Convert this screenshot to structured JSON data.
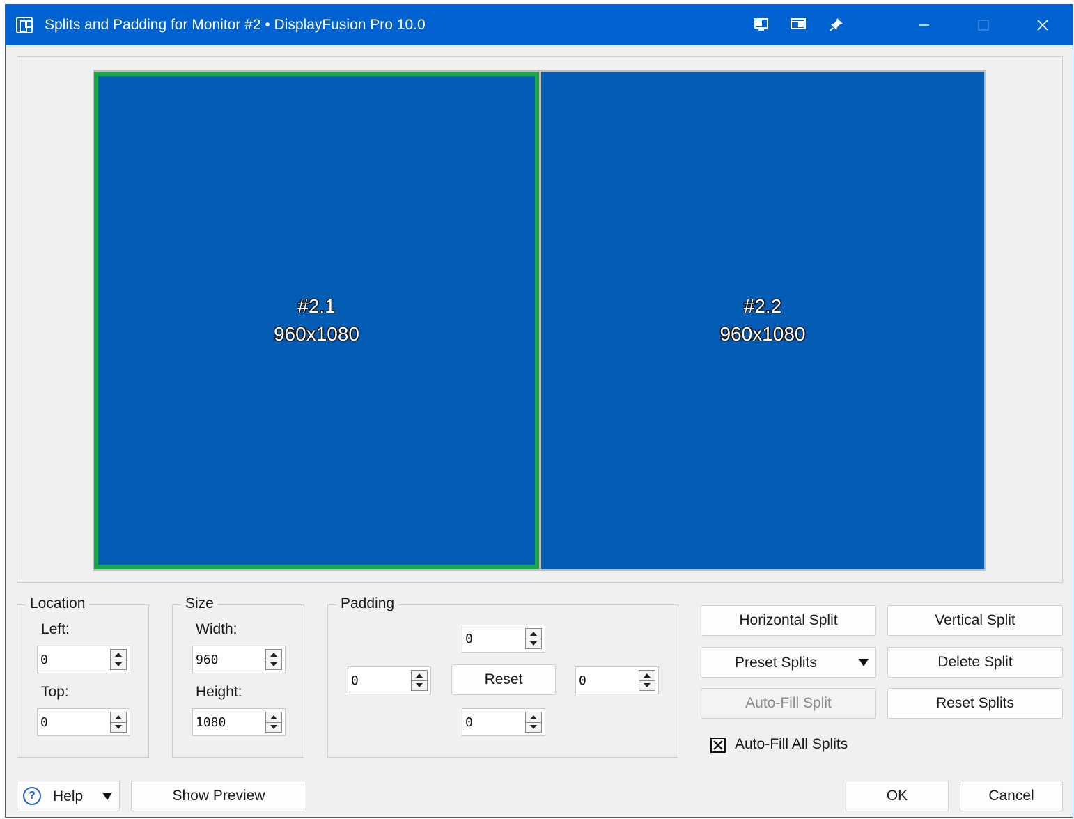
{
  "window": {
    "title": "Splits and Padding for Monitor #2 • DisplayFusion Pro 10.0",
    "accent_color": "#0063d1",
    "titlebar_icons": [
      "monitor-layout-icon",
      "window-split-icon",
      "pin-icon"
    ],
    "controls": [
      "minimize-icon",
      "maximize-icon",
      "close-icon"
    ]
  },
  "preview": {
    "splits": [
      {
        "name": "#2.1",
        "size": "960x1080",
        "selected": true,
        "color": "#045db5",
        "border_color": "#17a84a"
      },
      {
        "name": "#2.2",
        "size": "960x1080",
        "selected": false,
        "color": "#045db5"
      }
    ]
  },
  "location": {
    "title": "Location",
    "left_label": "Left:",
    "left_value": "0",
    "top_label": "Top:",
    "top_value": "0"
  },
  "size": {
    "title": "Size",
    "width_label": "Width:",
    "width_value": "960",
    "height_label": "Height:",
    "height_value": "1080"
  },
  "padding": {
    "title": "Padding",
    "top_value": "0",
    "left_value": "0",
    "right_value": "0",
    "bottom_value": "0",
    "reset_label": "Reset"
  },
  "split_actions": {
    "horizontal_split": "Horizontal Split",
    "vertical_split": "Vertical Split",
    "preset_splits": "Preset Splits",
    "delete_split": "Delete Split",
    "auto_fill_split": "Auto-Fill Split",
    "reset_splits": "Reset Splits",
    "auto_fill_all_label": "Auto-Fill All Splits",
    "auto_fill_all_checked": true
  },
  "footer": {
    "help_label": "Help",
    "show_preview_label": "Show Preview",
    "ok_label": "OK",
    "cancel_label": "Cancel"
  }
}
